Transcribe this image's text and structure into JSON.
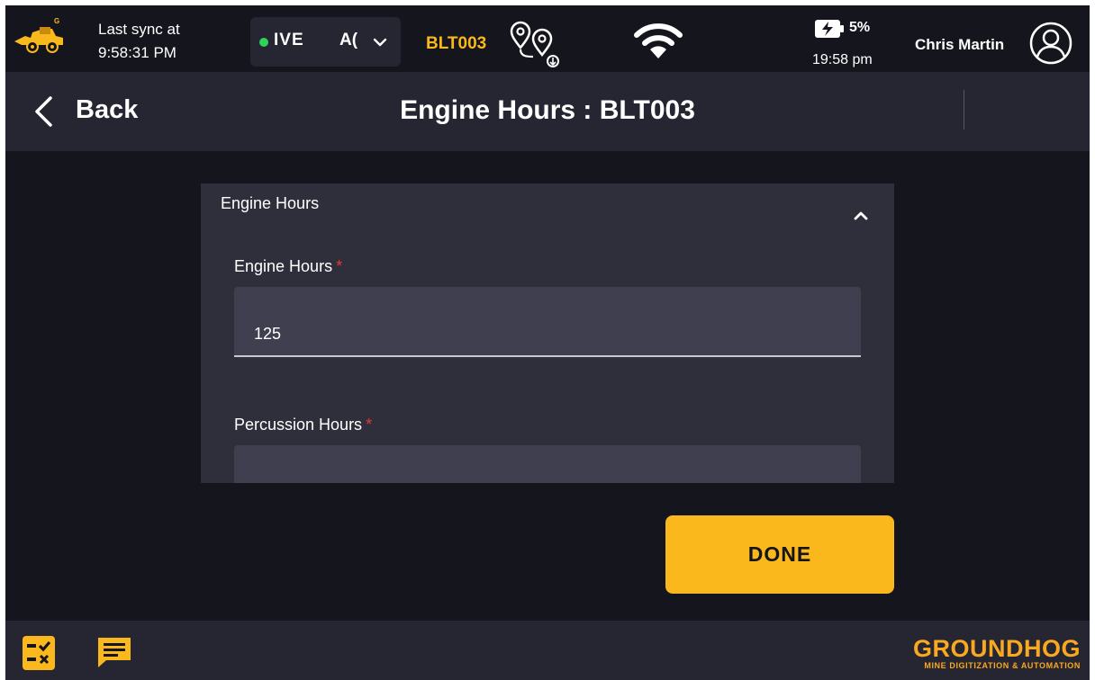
{
  "status": {
    "sync_label": "Last sync at",
    "sync_time": "9:58:31 PM",
    "mode_label": "IVE",
    "mode_label2": "A(",
    "equipment": "BLT003",
    "battery": "5%",
    "clock": "19:58 pm",
    "user": "Chris Martin"
  },
  "header": {
    "back_label": "Back",
    "title": "Engine Hours : BLT003"
  },
  "form": {
    "section_title": "Engine Hours",
    "fields": [
      {
        "label": "Engine Hours",
        "required_mark": "*",
        "value": "125"
      },
      {
        "label": "Percussion Hours",
        "required_mark": "*",
        "value": ""
      }
    ]
  },
  "actions": {
    "done_label": "DONE"
  },
  "brand": {
    "name": "GROUNDHOG",
    "tagline": "MINE DIGITIZATION & AUTOMATION"
  },
  "colors": {
    "accent": "#fbb81c",
    "background": "#15151d",
    "panel": "#262633",
    "card": "#2f2f3c",
    "live": "#2ed35a",
    "required": "#e53935"
  },
  "icons": [
    "machine-logo-icon",
    "chevron-down-icon",
    "route-map-icon",
    "wifi-icon",
    "battery-charging-icon",
    "user-avatar-icon",
    "back-chevron-icon",
    "collapse-chevron-icon",
    "checklist-icon",
    "message-icon"
  ]
}
